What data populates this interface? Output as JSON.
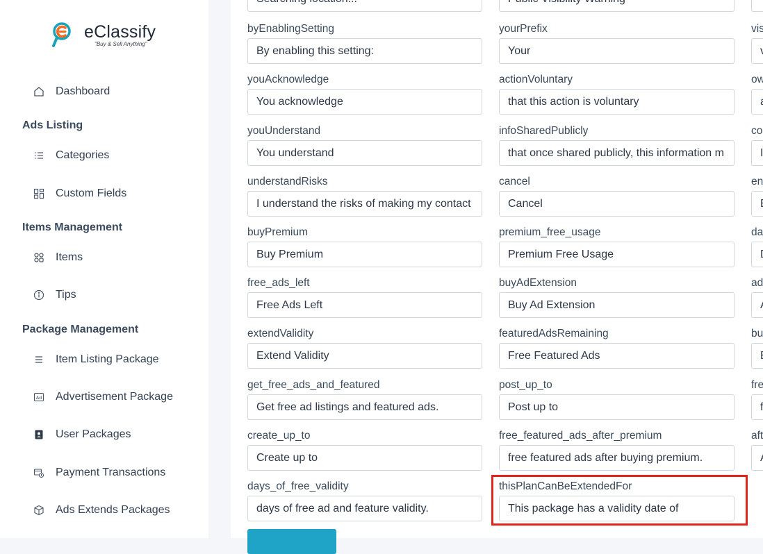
{
  "app": {
    "name": "eClassify",
    "tagline": "\"Buy & Sell Anything\""
  },
  "sidebar": {
    "dashboard": "Dashboard",
    "sections": {
      "ads_listing": "Ads Listing",
      "items_management": "Items Management",
      "package_management": "Package Management"
    },
    "items": {
      "categories": "Categories",
      "custom_fields": "Custom Fields",
      "items": "Items",
      "tips": "Tips",
      "item_listing_package": "Item Listing Package",
      "advertisement_package": "Advertisement Package",
      "user_packages": "User Packages",
      "payment_transactions": "Payment Transactions",
      "ads_extends_packages": "Ads Extends Packages"
    }
  },
  "form": {
    "top_partial": {
      "col1_value": "Searching location...",
      "col2_value": "Public Visibility Warning"
    },
    "col1": [
      {
        "label": "byEnablingSetting",
        "value": "By enabling this setting:"
      },
      {
        "label": "youAcknowledge",
        "value": "You acknowledge"
      },
      {
        "label": "youUnderstand",
        "value": "You understand"
      },
      {
        "label": "understandRisks",
        "value": "I understand the risks of making my contact"
      },
      {
        "label": "buyPremium",
        "value": "Buy Premium"
      },
      {
        "label": "free_ads_left",
        "value": "Free Ads Left"
      },
      {
        "label": "extendValidity",
        "value": "Extend Validity"
      },
      {
        "label": "get_free_ads_and_featured",
        "value": "Get free ad listings and featured ads."
      },
      {
        "label": "create_up_to",
        "value": "Create up to"
      },
      {
        "label": "days_of_free_validity",
        "value": "days of free ad and feature validity."
      }
    ],
    "col2": [
      {
        "label": "yourPrefix",
        "value": "Your"
      },
      {
        "label": "actionVoluntary",
        "value": "that this action is voluntary"
      },
      {
        "label": "infoSharedPublicly",
        "value": "that once shared publicly, this information m"
      },
      {
        "label": "cancel",
        "value": "Cancel"
      },
      {
        "label": "premium_free_usage",
        "value": "Premium Free Usage"
      },
      {
        "label": "buyAdExtension",
        "value": "Buy Ad Extension"
      },
      {
        "label": "featuredAdsRemaining",
        "value": "Free Featured Ads"
      },
      {
        "label": "post_up_to",
        "value": "Post up to"
      },
      {
        "label": "free_featured_ads_after_premium",
        "value": "free featured ads after buying premium."
      },
      {
        "label": "thisPlanCanBeExtendedFor",
        "value": "This package has a validity date of"
      }
    ],
    "col3": [
      {
        "label": "vis",
        "value": "v"
      },
      {
        "label": "ow",
        "value": "a"
      },
      {
        "label": "co",
        "value": "I"
      },
      {
        "label": "en",
        "value": "E"
      },
      {
        "label": "da",
        "value": "D"
      },
      {
        "label": "ad",
        "value": "A"
      },
      {
        "label": "bu",
        "value": "B"
      },
      {
        "label": "fre",
        "value": "f"
      },
      {
        "label": "aft",
        "value": "A"
      }
    ]
  },
  "colors": {
    "highlight": "#e3241b",
    "brand_orange": "#f26b21",
    "brand_teal": "#1aa3b8",
    "save_button": "#1fa3c6"
  }
}
